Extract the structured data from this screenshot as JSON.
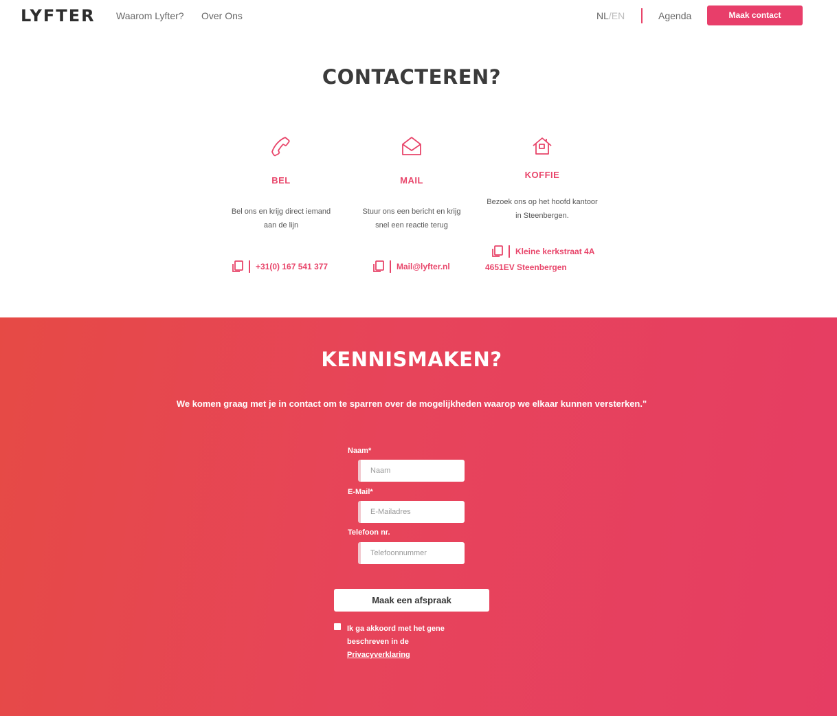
{
  "nav": {
    "logo": "LYFTER",
    "links": [
      "Waarom Lyfter?",
      "Over Ons"
    ],
    "lang_nl": "NL",
    "lang_sep": "/",
    "lang_en": "EN",
    "agenda": "Agenda",
    "cta": "Maak contact"
  },
  "contact": {
    "heading": "CONTACTEREN?",
    "columns": [
      {
        "icon": "phone-icon",
        "title": "BEL",
        "desc": "Bel ons en krijg direct iemand aan de lijn",
        "value": "+31(0) 167 541 377"
      },
      {
        "icon": "mail-icon",
        "title": "MAIL",
        "desc": "Stuur ons een bericht en krijg snel een reactie terug",
        "value": "Mail@lyfter.nl"
      },
      {
        "icon": "house-icon",
        "title": "KOFFIE",
        "desc": "Bezoek ons op het hoofd kantoor in Steenbergen.",
        "value_line1": "Kleine kerkstraat 4A",
        "value_line2": "4651EV Steenbergen"
      }
    ]
  },
  "kennismaken": {
    "heading": "KENNISMAKEN?",
    "intro": "We komen graag met je in contact om te sparren over de mogelijkheden waarop we elkaar kunnen versterken.\"",
    "form": {
      "name_label": "Naam*",
      "name_placeholder": "Naam",
      "email_label": "E-Mail*",
      "email_placeholder": "E-Mailadres",
      "phone_label": "Telefoon nr.",
      "phone_placeholder": "Telefoonnummer",
      "submit": "Maak een afspraak",
      "agree_text": "Ik ga akkoord met het gene beschreven in de",
      "agree_link": "Privacyverklaring"
    }
  },
  "colors": {
    "accent": "#e8456a",
    "gradient_start": "#e64a45",
    "gradient_end": "#e63d63"
  }
}
